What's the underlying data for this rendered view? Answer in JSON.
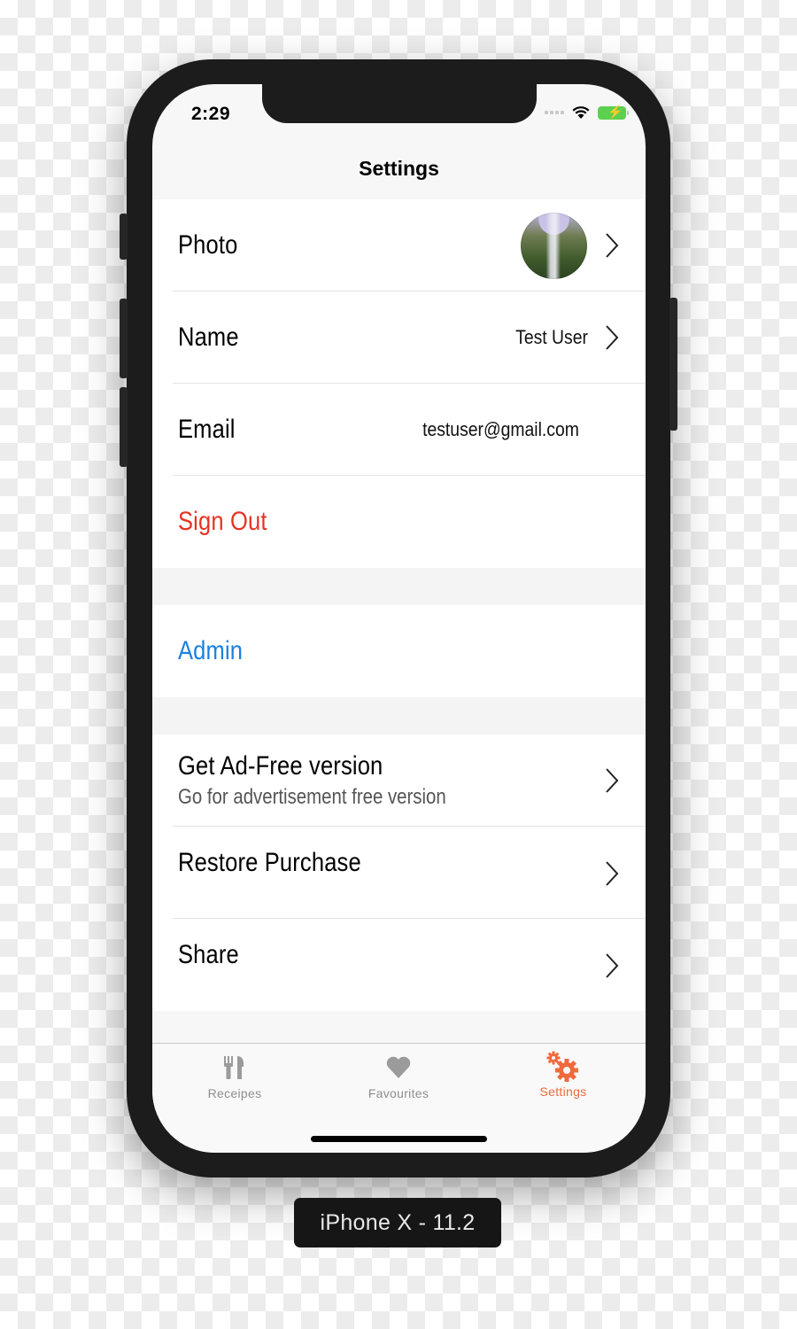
{
  "status_bar": {
    "time": "2:29",
    "icons": [
      "signal-dots-icon",
      "wifi-icon",
      "battery-charging-icon"
    ],
    "battery_color": "#5ed04f"
  },
  "nav": {
    "title": "Settings"
  },
  "sections": [
    {
      "rows": [
        {
          "label": "Photo",
          "accessory": "chevron",
          "avatar": "waterfall-photo"
        },
        {
          "label": "Name",
          "value": "Test User",
          "accessory": "chevron"
        },
        {
          "label": "Email",
          "value": "testuser@gmail.com"
        },
        {
          "label": "Sign Out",
          "color": "#e53323"
        }
      ]
    },
    {
      "rows": [
        {
          "label": "Admin",
          "color": "#1a7fe0"
        }
      ]
    },
    {
      "rows": [
        {
          "label": "Get Ad-Free version",
          "subtitle": "Go for advertisement free version",
          "accessory": "chevron"
        },
        {
          "label": "Restore Purchase",
          "accessory": "chevron"
        },
        {
          "label": "Share",
          "accessory": "chevron"
        }
      ]
    }
  ],
  "tabbar": {
    "tabs": [
      {
        "label": "Receipes",
        "icon": "fork-knife-icon",
        "active": false
      },
      {
        "label": "Favourites",
        "icon": "heart-icon",
        "active": false
      },
      {
        "label": "Settings",
        "icon": "gears-icon",
        "active": true
      }
    ],
    "active_color": "#f06a3d",
    "inactive_color": "#8e8e8e"
  },
  "device_label": "iPhone X - 11.2"
}
